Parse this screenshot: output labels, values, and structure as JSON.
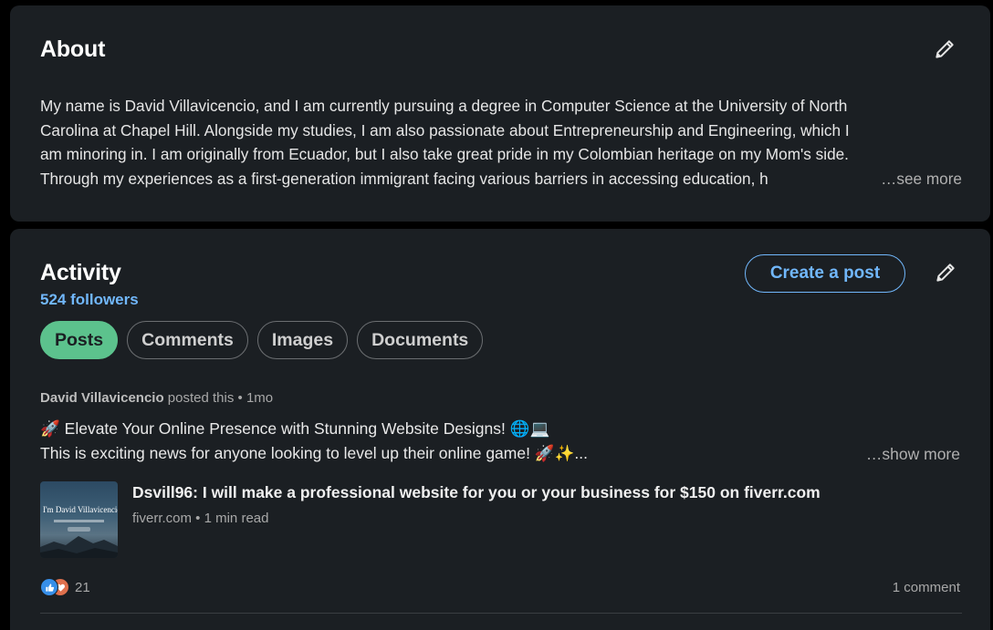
{
  "about": {
    "title": "About",
    "lines": [
      "My name is David Villavicencio, and I am currently pursuing a degree in Computer Science at the University of North",
      "Carolina at Chapel Hill. Alongside my studies, I am also passionate about Entrepreneurship and Engineering, which I",
      "am minoring in. I am originally from Ecuador, but I also take great pride in my Colombian heritage on my Mom's side.",
      "Through my experiences as a first-generation immigrant facing various barriers in accessing education, h"
    ],
    "see_more": "…see more",
    "edit_icon": "pencil-icon"
  },
  "activity": {
    "title": "Activity",
    "followers": "524 followers",
    "create_post": "Create a post",
    "edit_icon": "pencil-icon",
    "tabs": [
      {
        "label": "Posts",
        "active": true
      },
      {
        "label": "Comments",
        "active": false
      },
      {
        "label": "Images",
        "active": false
      },
      {
        "label": "Documents",
        "active": false
      }
    ],
    "post": {
      "author": "David Villavicencio",
      "action": "posted this",
      "separator": "•",
      "time": "1mo",
      "line1": "🚀 Elevate Your Online Presence with Stunning Website Designs! 🌐💻",
      "line2": "This is exciting news for anyone looking to level up their online game! 🚀✨...",
      "show_more": "…show more",
      "link": {
        "thumb_title": "I'm David Villavicencio.",
        "title": "Dsvill96: I will make a professional website for you or your business for $150 on fiverr.com",
        "subtitle": "fiverr.com • 1 min read"
      },
      "reactions": {
        "icons": [
          "like-icon",
          "love-icon"
        ],
        "count": "21"
      },
      "comments": "1 comment"
    }
  },
  "colors": {
    "background": "#000000",
    "card": "#1b1f23",
    "accent_blue": "#71b7fb",
    "active_tab": "#5cc28d"
  }
}
